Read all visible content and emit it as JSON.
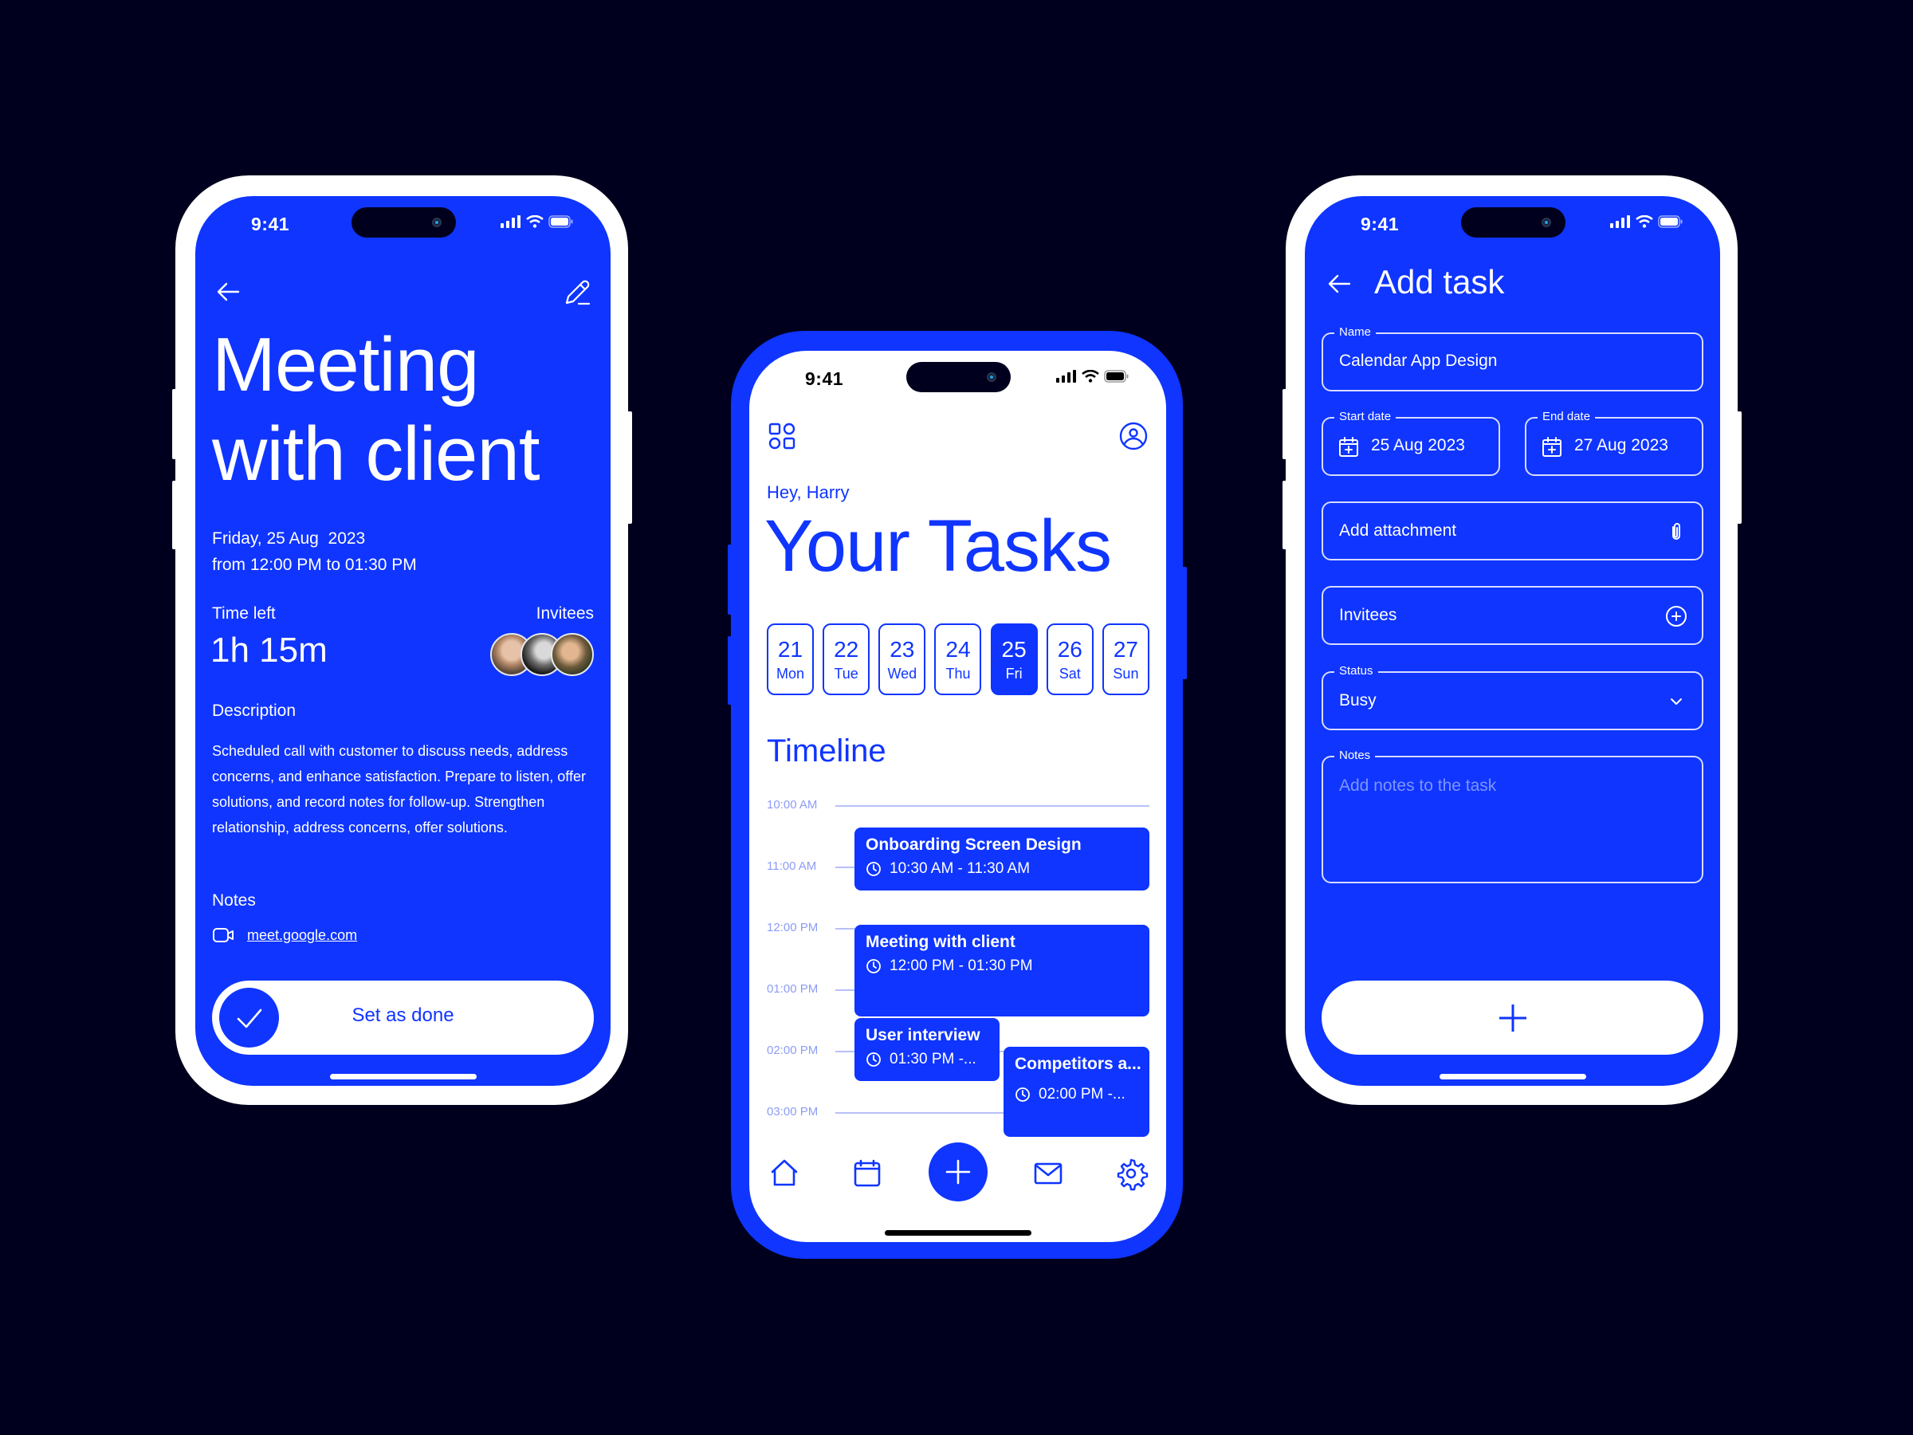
{
  "theme": {
    "accent": "#0f35ff",
    "background": "#00001e",
    "surface": "#ffffff"
  },
  "status_bar": {
    "time": "9:41"
  },
  "detail_screen": {
    "title": "Meeting with client",
    "date_line": "Friday, 25 Aug  2023",
    "time_line": "from 12:00 PM to 01:30 PM",
    "time_left_label": "Time left",
    "time_left_value": "1h 15m",
    "invitees_label": "Invitees",
    "invitee_count": 3,
    "description_label": "Description",
    "description": "Scheduled call with customer to discuss needs, address concerns, and enhance satisfaction. Prepare to listen, offer solutions, and record notes for follow-up. Strengthen relationship, address concerns, offer solutions.",
    "notes_label": "Notes",
    "notes_link": "meet.google.com",
    "done_button": "Set as done",
    "icons": {
      "back": "arrow-left-icon",
      "edit": "pencil-icon",
      "video": "video-camera-icon",
      "done": "check-icon"
    }
  },
  "tasks_screen": {
    "greeting": "Hey, Harry",
    "title": "Your Tasks",
    "days": [
      {
        "num": "21",
        "weekday": "Mon",
        "active": false
      },
      {
        "num": "22",
        "weekday": "Tue",
        "active": false
      },
      {
        "num": "23",
        "weekday": "Wed",
        "active": false
      },
      {
        "num": "24",
        "weekday": "Thu",
        "active": false
      },
      {
        "num": "25",
        "weekday": "Fri",
        "active": true
      },
      {
        "num": "26",
        "weekday": "Sat",
        "active": false
      },
      {
        "num": "27",
        "weekday": "Sun",
        "active": false
      }
    ],
    "timeline_title": "Timeline",
    "hours": [
      "10:00 AM",
      "11:00 AM",
      "12:00 PM",
      "01:00 PM",
      "02:00 PM",
      "03:00 PM"
    ],
    "events": [
      {
        "title": "Onboarding Screen Design",
        "time": "10:30 AM - 11:30 AM"
      },
      {
        "title": "Meeting with client",
        "time": "12:00 PM - 01:30 PM"
      },
      {
        "title": "User interview",
        "time": "01:30 PM -..."
      },
      {
        "title": "Competitors a...",
        "time": "02:00 PM -..."
      }
    ],
    "nav": [
      "home-icon",
      "calendar-icon",
      "plus-icon",
      "mail-icon",
      "settings-icon"
    ],
    "top_icons": {
      "menu": "grid-icon",
      "profile": "user-circle-icon"
    }
  },
  "add_task_screen": {
    "title": "Add task",
    "name_label": "Name",
    "name_value": "Calendar App Design",
    "start_label": "Start date",
    "start_value": "25 Aug 2023",
    "end_label": "End date",
    "end_value": "27 Aug 2023",
    "attachment_label": "Add attachment",
    "invitees_label": "Invitees",
    "status_label": "Status",
    "status_value": "Busy",
    "notes_label": "Notes",
    "notes_placeholder": "Add notes to the task",
    "icons": {
      "back": "arrow-left-icon",
      "calendar": "calendar-plus-icon",
      "attachment": "paperclip-icon",
      "add": "plus-circle-icon",
      "dropdown": "chevron-down-icon",
      "submit": "plus-icon"
    }
  }
}
